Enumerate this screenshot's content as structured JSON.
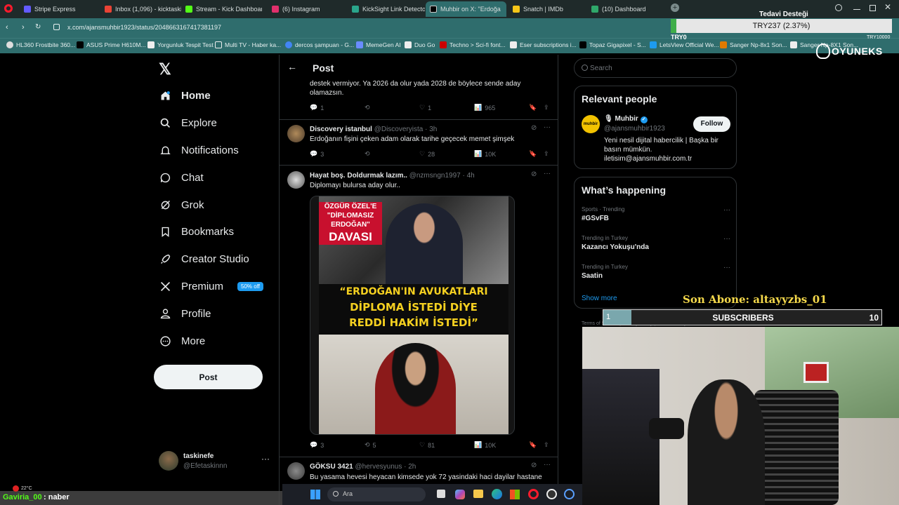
{
  "browser": {
    "tabs": [
      {
        "label": "Stripe Express",
        "color": "#635bff"
      },
      {
        "label": "Inbox (1,096) - kicktaskine",
        "color": "#ea4335"
      },
      {
        "label": "Stream - Kick Dashboard",
        "color": "#53fc18"
      },
      {
        "label": "(6) Instagram",
        "color": "#e1306c"
      },
      {
        "label": "KickSight Link Detector",
        "color": "#2aa58b"
      },
      {
        "label": "Muhbir on X: \"Erdoğa",
        "color": "#000000"
      },
      {
        "label": "Snatch | IMDb",
        "color": "#f5c518"
      },
      {
        "label": "(10) Dashboard",
        "color": "#2fa86a"
      }
    ],
    "url": "x.com/ajansmuhbir1923/status/2048663167417381197",
    "bookmarks": [
      "HL360 Frostbite 360...",
      "ASUS Prime H610M...",
      "Yorgunluk Tespit Test",
      "Multi TV - Haber ka...",
      "dercos şampuan - G...",
      "MemeGen AI",
      "Duo Go",
      "Techno > Sci-fi font...",
      "Eser subscriptions i...",
      "Topaz Gigapixel - S...",
      "LetsView Official We...",
      "Sanger Np-8x1 Son...",
      "Sanger Np-8X1 Son..."
    ]
  },
  "nav": {
    "items": [
      "Home",
      "Explore",
      "Notifications",
      "Chat",
      "Grok",
      "Bookmarks",
      "Creator Studio",
      "Premium",
      "Profile",
      "More"
    ],
    "premium_badge": "50% off",
    "post_button": "Post",
    "account_name": "taskinefe",
    "account_handle": "@Efetaskinnn"
  },
  "center": {
    "title": "Post",
    "reply0": {
      "text": "destek vermiyor. Ya 2026 da olur yada 2028 de böylece sende aday olamazsın.",
      "replies": "1",
      "likes": "1",
      "views": "965"
    },
    "reply1": {
      "name": "Discovery istanbul",
      "handle": "@Discoveryista · 3h",
      "text": "Erdoğanın fişini çeken adam olarak tarihe geçecek memet şimşek",
      "replies": "3",
      "likes": "28",
      "views": "10K"
    },
    "reply2": {
      "name": "Hayat boş. Doldurmak lazım..",
      "handle": "@nzmsngn1997 · 4h",
      "text": "Diplomayı bulursa aday olur..",
      "replies": "3",
      "reposts": "5",
      "likes": "81",
      "views": "10K",
      "image_text": {
        "top_line1": "ÖZGÜR ÖZEL'E",
        "top_line2": "\"DİPLOMASIZ",
        "top_line3": "ERDOĞAN\"",
        "top_line4": "DAVASI",
        "quote1": "“ERDOĞAN'IN AVUKATLARI",
        "quote2": "DİPLOMA İSTEDİ DİYE",
        "quote3": "REDDİ HAKİM İSTEDİ”"
      }
    },
    "reply3": {
      "name": "GÖKSU 3421",
      "handle": "@hervesyunus · 2h",
      "text": "Bu yasama hevesi heyacan kimsede yok 72 yasindaki haci dayilar hastane"
    }
  },
  "right": {
    "search_placeholder": "Search",
    "relevant_title": "Relevant people",
    "person_name": "Muhbir",
    "person_handle": "@ajansmuhbir1923",
    "follow_label": "Follow",
    "person_bio": "Yeni nesil dijital habercilik | Başka bir basın mümkün. iletisim@ajansmuhbir.com.tr",
    "happening_title": "What’s happening",
    "trends": [
      {
        "context": "Sports · Trending",
        "topic": "#GSvFB"
      },
      {
        "context": "Trending in Turkey",
        "topic": "Kazancı Yokuşu'nda"
      },
      {
        "context": "Trending in Turkey",
        "topic": "Saatin"
      }
    ],
    "show_more": "Show more",
    "footer": "Terms of Service | Privacy Policy | Cookie Policy"
  },
  "overlay": {
    "donation_title": "Tedavi Desteği",
    "donation_amount": "TRY237 (2.37%)",
    "donation_min": "TRY0",
    "donation_max": "TRY10000",
    "donation_progress": 0.0237,
    "brand": "OYUNEKS",
    "last_sub": "Son Abone: altayyzbs_01",
    "subs_current": "1",
    "subs_label": "SUBSCRIBERS",
    "subs_goal": "10",
    "chat_user": "Gaviria_00",
    "chat_msg": ": naber",
    "weather": "22°C",
    "taskbar_search": "Ara"
  }
}
